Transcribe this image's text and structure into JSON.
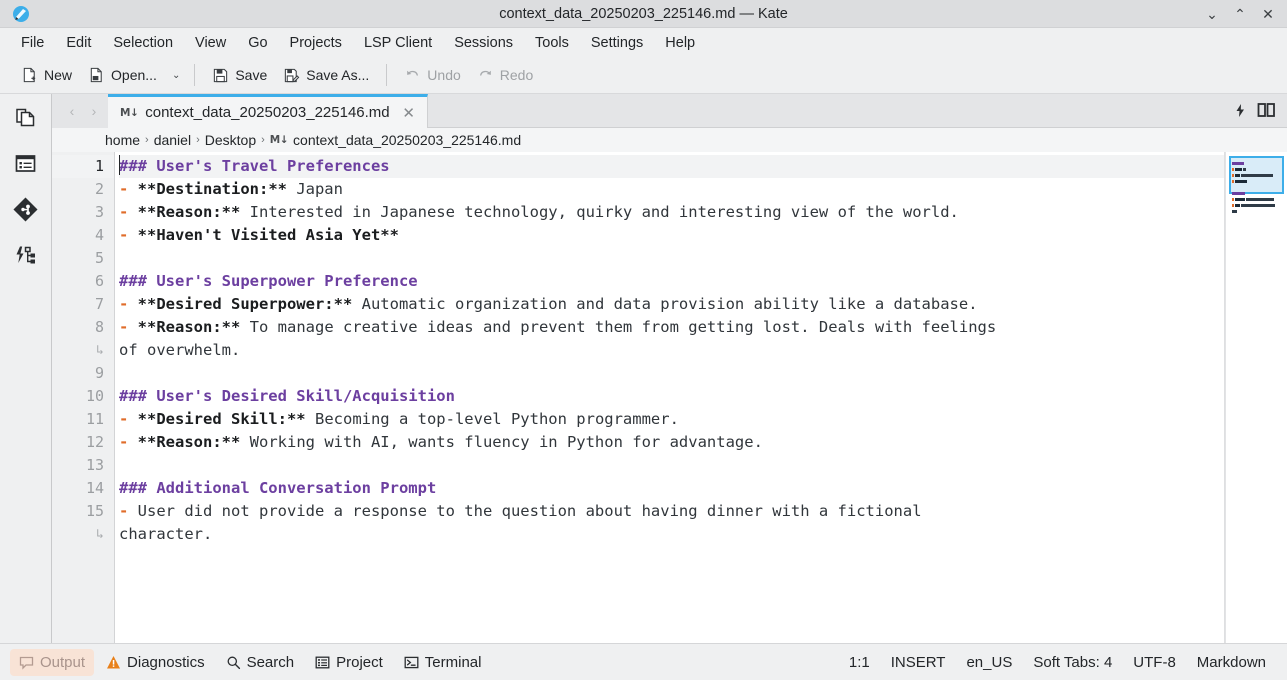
{
  "window": {
    "title": "context_data_20250203_225146.md — Kate",
    "app_icon": "kate-app-icon",
    "controls": [
      {
        "name": "minimize-button",
        "glyph": "⌄"
      },
      {
        "name": "maximize-button",
        "glyph": "⌃"
      },
      {
        "name": "close-button",
        "glyph": "✕"
      }
    ]
  },
  "menubar": {
    "items": [
      {
        "label": "File"
      },
      {
        "label": "Edit"
      },
      {
        "label": "Selection"
      },
      {
        "label": "View"
      },
      {
        "label": "Go"
      },
      {
        "label": "Projects"
      },
      {
        "label": "LSP Client"
      },
      {
        "label": "Sessions"
      },
      {
        "label": "Tools"
      },
      {
        "label": "Settings"
      },
      {
        "label": "Help"
      }
    ]
  },
  "toolbar": {
    "new_label": "New",
    "open_label": "Open...",
    "save_label": "Save",
    "save_as_label": "Save As...",
    "undo_label": "Undo",
    "redo_label": "Redo",
    "open_caret": "⌄"
  },
  "sidebar": {
    "items": [
      {
        "name": "documents-icon",
        "tooltip": "Documents"
      },
      {
        "name": "filesystem-browser-icon",
        "tooltip": "Filesystem Browser"
      },
      {
        "name": "git-icon",
        "tooltip": "Git"
      },
      {
        "name": "lsp-symbols-icon",
        "tooltip": "LSP Symbol Outline"
      }
    ]
  },
  "tabbar": {
    "prev_glyph": "‹",
    "next_glyph": "›",
    "md_badge": "M↓",
    "tab_title": "context_data_20250203_225146.md",
    "close_glyph": "✕",
    "tools": [
      {
        "name": "lsp-status-icon"
      },
      {
        "name": "split-view-icon"
      }
    ]
  },
  "breadcrumb": {
    "md_badge": "M↓",
    "parts": [
      "home",
      "daniel",
      "Desktop"
    ],
    "filename": "context_data_20250203_225146.md",
    "separator": "›"
  },
  "editor": {
    "wrap_marker": "↳",
    "lines": [
      {
        "number": "1",
        "current": true,
        "tokens": [
          {
            "t": "### User's Travel Preferences",
            "c": "tok-h"
          }
        ]
      },
      {
        "number": "2",
        "tokens": [
          {
            "t": "- ",
            "c": "tok-bullet"
          },
          {
            "t": "**Destination:**",
            "c": "tok-bold"
          },
          {
            "t": " Japan",
            "c": "tok-plain"
          }
        ]
      },
      {
        "number": "3",
        "tokens": [
          {
            "t": "- ",
            "c": "tok-bullet"
          },
          {
            "t": "**Reason:**",
            "c": "tok-bold"
          },
          {
            "t": " Interested in Japanese technology, quirky and interesting view of the world.",
            "c": "tok-plain"
          }
        ]
      },
      {
        "number": "4",
        "tokens": [
          {
            "t": "- ",
            "c": "tok-bullet"
          },
          {
            "t": "**Haven't Visited Asia Yet**",
            "c": "tok-bold"
          }
        ]
      },
      {
        "number": "5",
        "tokens": []
      },
      {
        "number": "6",
        "tokens": [
          {
            "t": "### User's Superpower Preference",
            "c": "tok-h"
          }
        ]
      },
      {
        "number": "7",
        "tokens": [
          {
            "t": "- ",
            "c": "tok-bullet"
          },
          {
            "t": "**Desired Superpower:**",
            "c": "tok-bold"
          },
          {
            "t": " Automatic organization and data provision ability like a database.",
            "c": "tok-plain"
          }
        ]
      },
      {
        "number": "8",
        "tokens": [
          {
            "t": "- ",
            "c": "tok-bullet"
          },
          {
            "t": "**Reason:**",
            "c": "tok-bold"
          },
          {
            "t": " To manage creative ideas and prevent them from getting lost. Deals with feelings",
            "c": "tok-plain"
          }
        ]
      },
      {
        "number": "↳",
        "wrapped": true,
        "tokens": [
          {
            "t": "of overwhelm.",
            "c": "tok-plain"
          }
        ]
      },
      {
        "number": "9",
        "tokens": []
      },
      {
        "number": "10",
        "tokens": [
          {
            "t": "### User's Desired Skill/Acquisition",
            "c": "tok-h"
          }
        ]
      },
      {
        "number": "11",
        "tokens": [
          {
            "t": "- ",
            "c": "tok-bullet"
          },
          {
            "t": "**Desired Skill:**",
            "c": "tok-bold"
          },
          {
            "t": " Becoming a top-level Python programmer.",
            "c": "tok-plain"
          }
        ]
      },
      {
        "number": "12",
        "tokens": [
          {
            "t": "- ",
            "c": "tok-bullet"
          },
          {
            "t": "**Reason:**",
            "c": "tok-bold"
          },
          {
            "t": " Working with AI, wants fluency in Python for advantage.",
            "c": "tok-plain"
          }
        ]
      },
      {
        "number": "13",
        "tokens": []
      },
      {
        "number": "14",
        "tokens": [
          {
            "t": "### Additional Conversation Prompt",
            "c": "tok-h"
          }
        ]
      },
      {
        "number": "15",
        "tokens": [
          {
            "t": "- ",
            "c": "tok-bullet"
          },
          {
            "t": "User did not provide a response to the question about having dinner with a fictional",
            "c": "tok-plain"
          }
        ]
      },
      {
        "number": "↳",
        "wrapped": true,
        "tokens": [
          {
            "t": "character.",
            "c": "tok-plain"
          }
        ]
      }
    ]
  },
  "statusbar": {
    "tools": [
      {
        "name": "output-button",
        "label": "Output",
        "icon": "output-icon",
        "muted": true
      },
      {
        "name": "diagnostics-button",
        "label": "Diagnostics",
        "icon": "warning-icon",
        "muted": false
      },
      {
        "name": "search-button",
        "label": "Search",
        "icon": "search-icon",
        "muted": false
      },
      {
        "name": "project-button",
        "label": "Project",
        "icon": "project-icon",
        "muted": false
      },
      {
        "name": "terminal-button",
        "label": "Terminal",
        "icon": "terminal-icon",
        "muted": false
      }
    ],
    "cursor_position": "1:1",
    "input_mode": "INSERT",
    "language_locale": "en_US",
    "tab_mode": "Soft Tabs: 4",
    "encoding": "UTF-8",
    "highlight_mode": "Markdown"
  },
  "colors": {
    "accent": "#3daee9",
    "heading": "#6c3fa0",
    "bullet": "#e06c2a",
    "chrome": "#eff0f1",
    "titlebar": "#dcdddf",
    "warning": "#e8801a"
  }
}
